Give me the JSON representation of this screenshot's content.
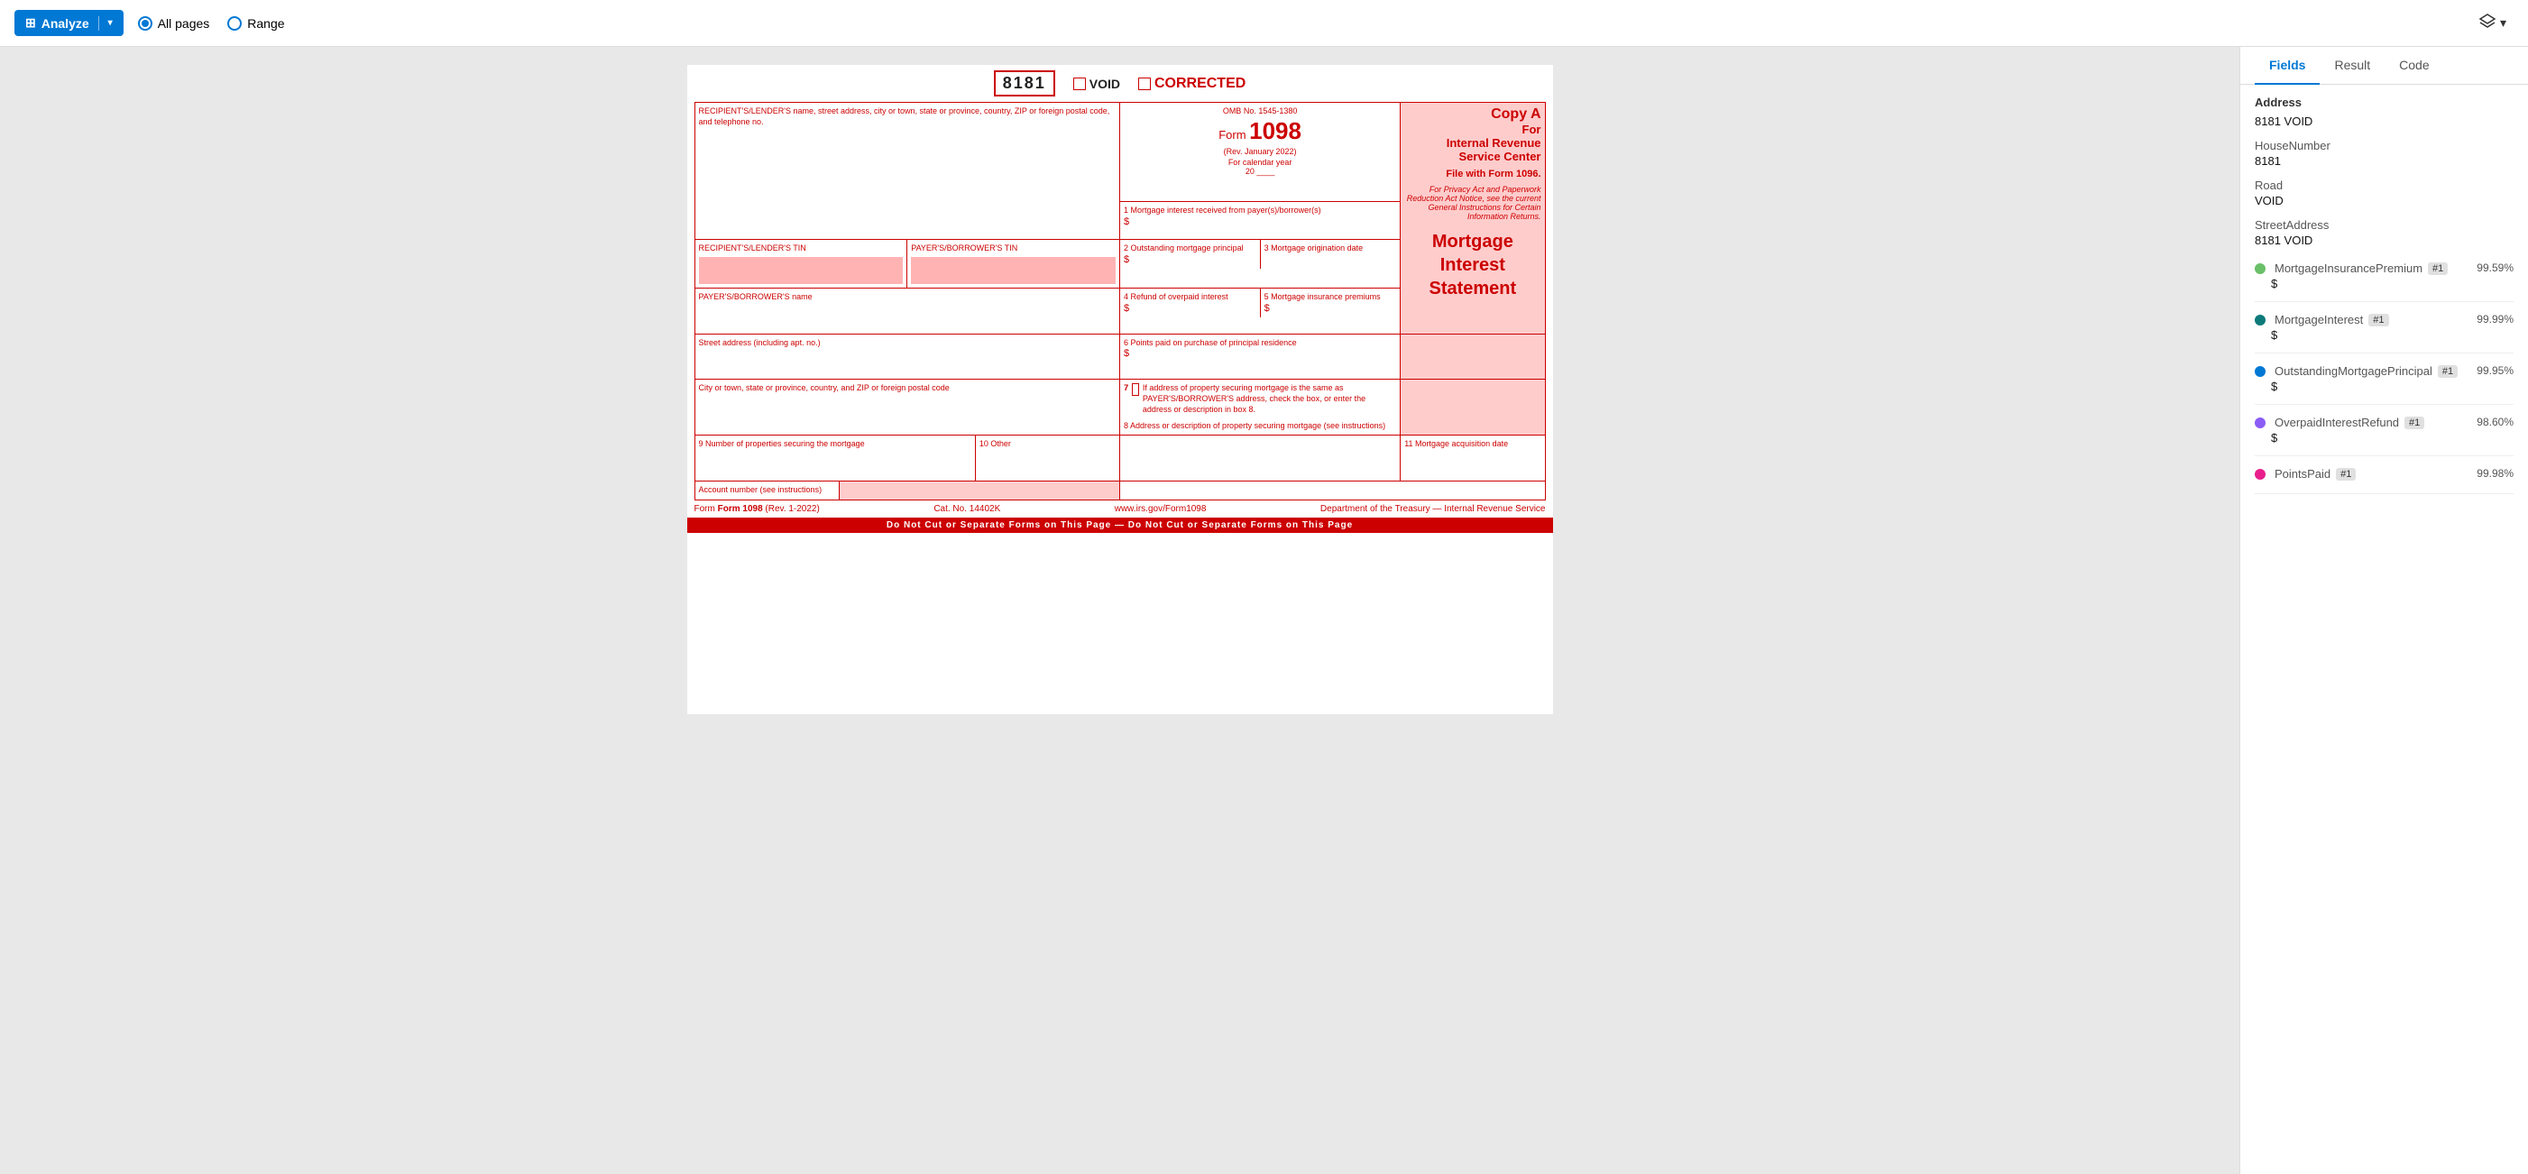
{
  "topbar": {
    "analyze_label": "Analyze",
    "all_pages_label": "All pages",
    "range_label": "Range",
    "layers_label": "≡"
  },
  "tabs": {
    "fields_label": "Fields",
    "result_label": "Result",
    "code_label": "Code"
  },
  "form": {
    "number_display": "8181",
    "void_label": "VOID",
    "corrected_label": "CORRECTED",
    "omb_no": "OMB No. 1545-1380",
    "form_number": "1098",
    "rev_date": "(Rev. January 2022)",
    "calendar_year": "For calendar year",
    "year_line": "20 ____",
    "copy_a": "Copy A",
    "for_irs": "For",
    "internal_revenue": "Internal Revenue",
    "service_center": "Service Center",
    "file_with": "File with Form 1096.",
    "privacy_notice": "For Privacy Act and Paperwork Reduction Act Notice, see the current General Instructions for Certain Information Returns.",
    "recipient_lender_label": "RECIPIENT'S/LENDER'S name, street address, city or town, state or province, country, ZIP or foreign postal code, and telephone no.",
    "recipient_tin_label": "RECIPIENT'S/LENDER'S TIN",
    "borrower_tin_label": "PAYER'S/BORROWER'S TIN",
    "borrower_name_label": "PAYER'S/BORROWER'S name",
    "street_address_label": "Street address (including apt. no.)",
    "city_label": "City or town, state or province, country, and ZIP or foreign postal code",
    "properties_label": "9 Number of properties securing the mortgage",
    "other_label": "10 Other",
    "account_label": "Account number (see instructions)",
    "box1_label": "1 Mortgage interest received from payer(s)/borrower(s)",
    "box2_label": "2 Outstanding mortgage principal",
    "box3_label": "3 Mortgage origination date",
    "box4_label": "4 Refund of overpaid interest",
    "box5_label": "5 Mortgage insurance premiums",
    "box6_label": "6 Points paid on purchase of principal residence",
    "box7_label": "7",
    "box7_text": "If address of property securing mortgage is the same as PAYER'S/BORROWER'S address, check the box, or enter the address or description in box 8.",
    "box8_label": "8 Address or description of property securing mortgage (see instructions)",
    "box11_label": "11 Mortgage acquisition date",
    "form_ref": "Form 1098",
    "rev_ref": "(Rev. 1-2022)",
    "cat_no": "Cat. No. 14402K",
    "irs_url": "www.irs.gov/Form1098",
    "dept_treasury": "Department of the Treasury — Internal Revenue Service",
    "do_not_cut": "Do Not Cut or Separate Forms on This Page — Do Not Cut or Separate Forms on This Page",
    "mortgage_statement": "Mortgage Interest Statement"
  },
  "fields_panel": {
    "address_section": "Address",
    "field_8181_void_label": "8181 VOID",
    "house_number_label": "HouseNumber",
    "house_number_value": "8181",
    "road_label": "Road",
    "road_value": "VOID",
    "street_address_label": "StreetAddress",
    "street_address_value": "8181 VOID",
    "fields": [
      {
        "name": "MortgageInsurancePremium",
        "badge": "#1",
        "confidence": "99.59%",
        "value": "$",
        "dot_color": "#6abf69"
      },
      {
        "name": "MortgageInterest",
        "badge": "#1",
        "confidence": "99.99%",
        "value": "$",
        "dot_color": "#0d7a7a"
      },
      {
        "name": "OutstandingMortgagePrincipal",
        "badge": "#1",
        "confidence": "99.95%",
        "value": "$",
        "dot_color": "#0078d4"
      },
      {
        "name": "OverpaidInterestRefund",
        "badge": "#1",
        "confidence": "98.60%",
        "value": "$",
        "dot_color": "#8b5cf6"
      },
      {
        "name": "PointsPaid",
        "badge": "#1",
        "confidence": "99.98%",
        "value": "",
        "dot_color": "#e91e8c"
      }
    ]
  }
}
